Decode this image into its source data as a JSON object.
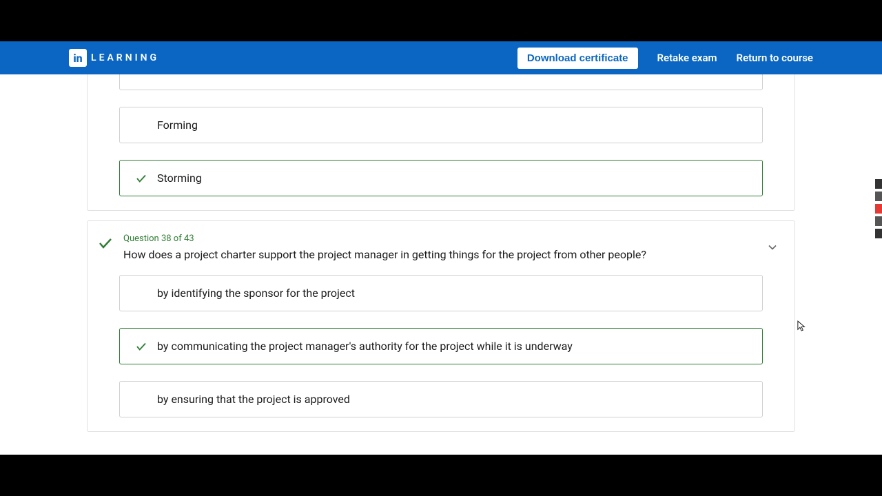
{
  "brand": {
    "icon_text": "in",
    "label": "LEARNING"
  },
  "nav": {
    "download_label": "Download certificate",
    "retake_label": "Retake exam",
    "return_label": "Return to course"
  },
  "q37": {
    "answers": [
      {
        "label": "",
        "correct": false
      },
      {
        "label": "Forming",
        "correct": false
      },
      {
        "label": "Storming",
        "correct": true
      }
    ]
  },
  "q38": {
    "meta": "Question 38 of 43",
    "text": "How does a project charter support the project manager in getting things for the project from other people?",
    "answers": [
      {
        "label": "by identifying the sponsor for the project",
        "correct": false
      },
      {
        "label": "by communicating the project manager's authority for the project while it is underway",
        "correct": true
      },
      {
        "label": "by ensuring that the project is approved",
        "correct": false
      }
    ]
  },
  "colors": {
    "navbar": "#0a66c2",
    "correct": "#2e7d32"
  }
}
